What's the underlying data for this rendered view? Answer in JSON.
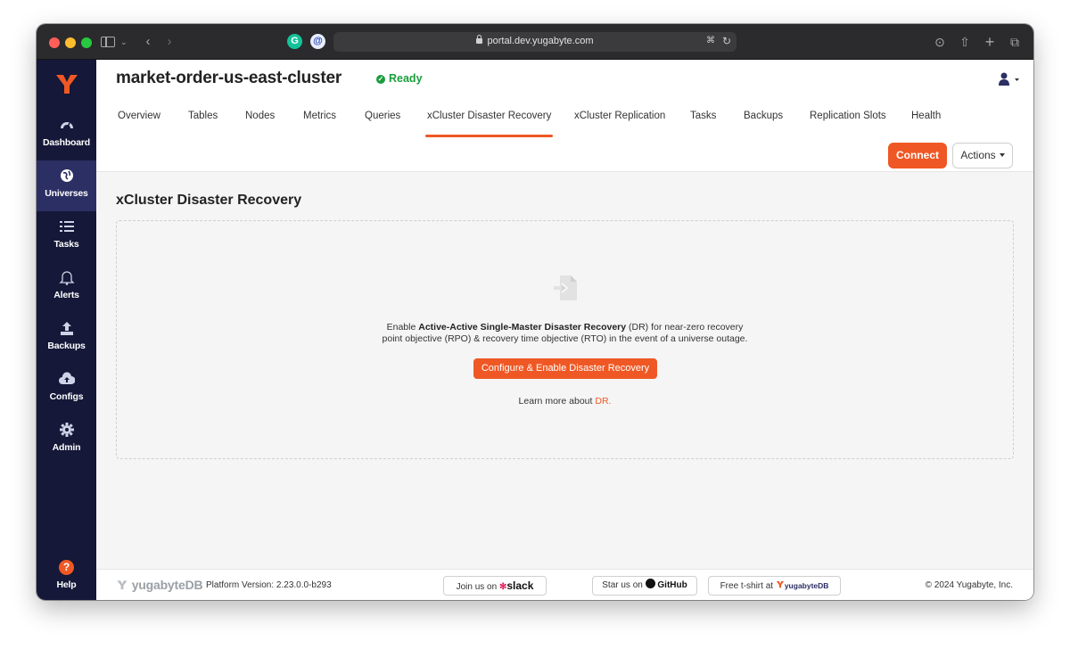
{
  "browser": {
    "url": "portal.dev.yugabyte.com"
  },
  "nav": {
    "items": [
      {
        "label": "Dashboard",
        "icon": "dashboard-icon",
        "active": false
      },
      {
        "label": "Universes",
        "icon": "globe-icon",
        "active": true
      },
      {
        "label": "Tasks",
        "icon": "list-icon",
        "active": false
      },
      {
        "label": "Alerts",
        "icon": "bell-icon",
        "active": false
      },
      {
        "label": "Backups",
        "icon": "upload-icon",
        "active": false
      },
      {
        "label": "Configs",
        "icon": "cloud-upload-icon",
        "active": false
      },
      {
        "label": "Admin",
        "icon": "gear-icon",
        "active": false
      }
    ],
    "help": {
      "label": "Help",
      "glyph": "?"
    }
  },
  "header": {
    "title": "market-order-us-east-cluster",
    "status": "Ready",
    "tabs": [
      {
        "label": "Overview",
        "active": false
      },
      {
        "label": "Tables",
        "active": false
      },
      {
        "label": "Nodes",
        "active": false
      },
      {
        "label": "Metrics",
        "active": false
      },
      {
        "label": "Queries",
        "active": false
      },
      {
        "label": "xCluster Disaster Recovery",
        "active": true
      },
      {
        "label": "xCluster Replication",
        "active": false
      },
      {
        "label": "Tasks",
        "active": false
      },
      {
        "label": "Backups",
        "active": false
      },
      {
        "label": "Replication Slots",
        "active": false
      },
      {
        "label": "Health",
        "active": false
      }
    ],
    "connect_label": "Connect",
    "actions_label": "Actions"
  },
  "main": {
    "section_title": "xCluster Disaster Recovery",
    "desc_prefix": "Enable ",
    "desc_bold": "Active-Active Single-Master Disaster Recovery",
    "desc_line1_suffix": " (DR) for near-zero recovery",
    "desc_line2": "point objective (RPO) & recovery time objective (RTO) in the event of a universe outage.",
    "configure_button": "Configure & Enable Disaster Recovery",
    "learn_more_text": "Learn more about ",
    "learn_more_link": "DR."
  },
  "footer": {
    "brand": "yugabyteDB",
    "version": "Platform Version: 2.23.0.0-b293",
    "slack_prefix": "Join us on",
    "slack_brand": "slack",
    "github_prefix": "Star us on",
    "github_brand": "GitHub",
    "tshirt_prefix": "Free t-shirt at",
    "tshirt_brand": "yugabyteDB",
    "copyright": "© 2024 Yugabyte, Inc."
  },
  "colors": {
    "accent": "#ef5824",
    "nav_bg": "#151838",
    "nav_active": "#2b2f63",
    "status_green": "#1a9d3c"
  }
}
